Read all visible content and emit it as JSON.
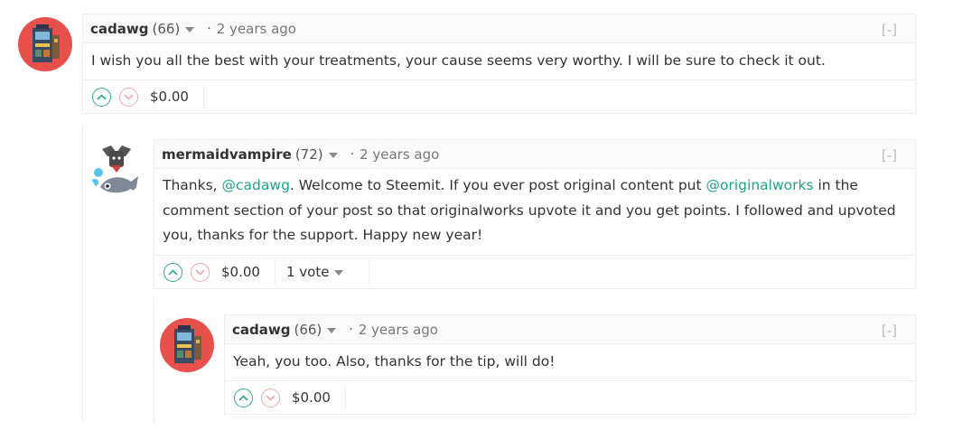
{
  "comments": [
    {
      "author": "cadawg",
      "reputation": "(66)",
      "separator": "·",
      "time": "2 years ago",
      "collapse": "[-]",
      "body": "I wish you all the best with your treatments, your cause seems very worthy. I will be sure to check it out.",
      "payout": "$0.00"
    },
    {
      "author": "mermaidvampire",
      "reputation": "(72)",
      "separator": "·",
      "time": "2 years ago",
      "collapse": "[-]",
      "body_parts": {
        "p1": "Thanks, ",
        "mention1": "@cadawg",
        "p2": ". Welcome to Steemit. If you ever post original content put ",
        "mention2": "@originalworks",
        "p3": " in the comment section of your post so that originalworks upvote it and you get points. I followed and upvoted you, thanks for the support. Happy new year!"
      },
      "payout": "$0.00",
      "votes": "1 vote"
    },
    {
      "author": "cadawg",
      "reputation": "(66)",
      "separator": "·",
      "time": "2 years ago",
      "collapse": "[-]",
      "body": "Yeah, you too. Also, thanks for the tip, will do!",
      "payout": "$0.00"
    }
  ],
  "icons": {
    "upvote": "chevron-up-circle-icon",
    "downvote": "chevron-down-circle-icon",
    "dropdown": "caret-down-icon"
  },
  "colors": {
    "link": "#1fa288",
    "upvote": "#2aa888",
    "downvote": "#f2a7a7",
    "avatar_cadawg_bg": "#e8504c"
  }
}
